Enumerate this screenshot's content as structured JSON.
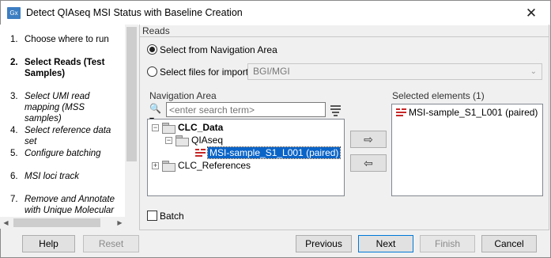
{
  "window": {
    "title": "Detect QIAseq MSI Status with Baseline Creation",
    "app_icon": "Gx",
    "close_glyph": "✕"
  },
  "steps": [
    {
      "num": "1.",
      "label": "Choose where to run"
    },
    {
      "num": "2.",
      "label": "Select Reads (Test Samples)"
    },
    {
      "num": "3.",
      "label": "Select UMI read mapping (MSS samples)"
    },
    {
      "num": "4.",
      "label": "Select reference data set"
    },
    {
      "num": "5.",
      "label": "Configure batching"
    },
    {
      "num": "6.",
      "label": "MSI loci track"
    },
    {
      "num": "7.",
      "label": "Remove and Annotate with Unique Molecular Index"
    }
  ],
  "reads": {
    "section_title": "Reads",
    "option_nav": "Select from Navigation Area",
    "option_files": "Select files for import:",
    "import_format": "BGI/MGI",
    "selected_option": "nav"
  },
  "navigation": {
    "label": "Navigation Area",
    "search_placeholder": "<enter search term>",
    "tree": [
      {
        "label": "CLC_Data",
        "expander": "−"
      },
      {
        "label": "QIAseq",
        "expander": "−"
      },
      {
        "label": "MSI-sample_S1_L001 (paired)"
      },
      {
        "label": "CLC_References",
        "expander": "+"
      }
    ]
  },
  "selected": {
    "label": "Selected elements (1)",
    "items": [
      {
        "label": "MSI-sample_S1_L001 (paired)"
      }
    ]
  },
  "batch": {
    "label": "Batch",
    "checked": false
  },
  "buttons": {
    "help": "Help",
    "reset": "Reset",
    "previous": "Previous",
    "next": "Next",
    "finish": "Finish",
    "cancel": "Cancel",
    "add_arrow": "⇨",
    "remove_arrow": "⇦"
  },
  "colors": {
    "selection": "#0a64c8",
    "sequence_icon": "#c62828"
  },
  "icons": [
    "search-icon",
    "filter-icon",
    "folder-icon",
    "sequence-list-icon",
    "right-arrow-icon",
    "left-arrow-icon"
  ]
}
